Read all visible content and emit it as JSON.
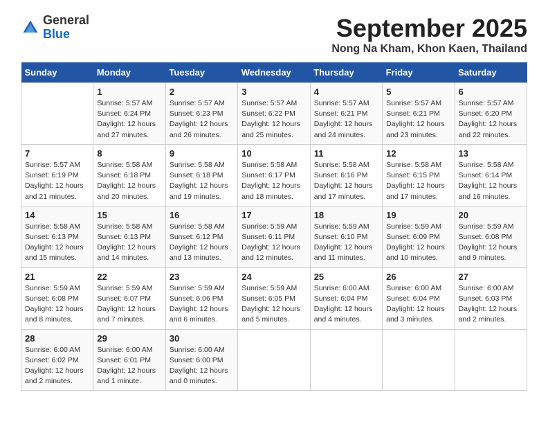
{
  "logo": {
    "general": "General",
    "blue": "Blue"
  },
  "header": {
    "month": "September 2025",
    "location": "Nong Na Kham, Khon Kaen, Thailand"
  },
  "weekdays": [
    "Sunday",
    "Monday",
    "Tuesday",
    "Wednesday",
    "Thursday",
    "Friday",
    "Saturday"
  ],
  "weeks": [
    [
      {
        "day": "",
        "info": ""
      },
      {
        "day": "1",
        "info": "Sunrise: 5:57 AM\nSunset: 6:24 PM\nDaylight: 12 hours\nand 27 minutes."
      },
      {
        "day": "2",
        "info": "Sunrise: 5:57 AM\nSunset: 6:23 PM\nDaylight: 12 hours\nand 26 minutes."
      },
      {
        "day": "3",
        "info": "Sunrise: 5:57 AM\nSunset: 6:22 PM\nDaylight: 12 hours\nand 25 minutes."
      },
      {
        "day": "4",
        "info": "Sunrise: 5:57 AM\nSunset: 6:21 PM\nDaylight: 12 hours\nand 24 minutes."
      },
      {
        "day": "5",
        "info": "Sunrise: 5:57 AM\nSunset: 6:21 PM\nDaylight: 12 hours\nand 23 minutes."
      },
      {
        "day": "6",
        "info": "Sunrise: 5:57 AM\nSunset: 6:20 PM\nDaylight: 12 hours\nand 22 minutes."
      }
    ],
    [
      {
        "day": "7",
        "info": "Sunrise: 5:57 AM\nSunset: 6:19 PM\nDaylight: 12 hours\nand 21 minutes."
      },
      {
        "day": "8",
        "info": "Sunrise: 5:58 AM\nSunset: 6:18 PM\nDaylight: 12 hours\nand 20 minutes."
      },
      {
        "day": "9",
        "info": "Sunrise: 5:58 AM\nSunset: 6:18 PM\nDaylight: 12 hours\nand 19 minutes."
      },
      {
        "day": "10",
        "info": "Sunrise: 5:58 AM\nSunset: 6:17 PM\nDaylight: 12 hours\nand 18 minutes."
      },
      {
        "day": "11",
        "info": "Sunrise: 5:58 AM\nSunset: 6:16 PM\nDaylight: 12 hours\nand 17 minutes."
      },
      {
        "day": "12",
        "info": "Sunrise: 5:58 AM\nSunset: 6:15 PM\nDaylight: 12 hours\nand 17 minutes."
      },
      {
        "day": "13",
        "info": "Sunrise: 5:58 AM\nSunset: 6:14 PM\nDaylight: 12 hours\nand 16 minutes."
      }
    ],
    [
      {
        "day": "14",
        "info": "Sunrise: 5:58 AM\nSunset: 6:13 PM\nDaylight: 12 hours\nand 15 minutes."
      },
      {
        "day": "15",
        "info": "Sunrise: 5:58 AM\nSunset: 6:13 PM\nDaylight: 12 hours\nand 14 minutes."
      },
      {
        "day": "16",
        "info": "Sunrise: 5:58 AM\nSunset: 6:12 PM\nDaylight: 12 hours\nand 13 minutes."
      },
      {
        "day": "17",
        "info": "Sunrise: 5:59 AM\nSunset: 6:11 PM\nDaylight: 12 hours\nand 12 minutes."
      },
      {
        "day": "18",
        "info": "Sunrise: 5:59 AM\nSunset: 6:10 PM\nDaylight: 12 hours\nand 11 minutes."
      },
      {
        "day": "19",
        "info": "Sunrise: 5:59 AM\nSunset: 6:09 PM\nDaylight: 12 hours\nand 10 minutes."
      },
      {
        "day": "20",
        "info": "Sunrise: 5:59 AM\nSunset: 6:08 PM\nDaylight: 12 hours\nand 9 minutes."
      }
    ],
    [
      {
        "day": "21",
        "info": "Sunrise: 5:59 AM\nSunset: 6:08 PM\nDaylight: 12 hours\nand 8 minutes."
      },
      {
        "day": "22",
        "info": "Sunrise: 5:59 AM\nSunset: 6:07 PM\nDaylight: 12 hours\nand 7 minutes."
      },
      {
        "day": "23",
        "info": "Sunrise: 5:59 AM\nSunset: 6:06 PM\nDaylight: 12 hours\nand 6 minutes."
      },
      {
        "day": "24",
        "info": "Sunrise: 5:59 AM\nSunset: 6:05 PM\nDaylight: 12 hours\nand 5 minutes."
      },
      {
        "day": "25",
        "info": "Sunrise: 6:00 AM\nSunset: 6:04 PM\nDaylight: 12 hours\nand 4 minutes."
      },
      {
        "day": "26",
        "info": "Sunrise: 6:00 AM\nSunset: 6:04 PM\nDaylight: 12 hours\nand 3 minutes."
      },
      {
        "day": "27",
        "info": "Sunrise: 6:00 AM\nSunset: 6:03 PM\nDaylight: 12 hours\nand 2 minutes."
      }
    ],
    [
      {
        "day": "28",
        "info": "Sunrise: 6:00 AM\nSunset: 6:02 PM\nDaylight: 12 hours\nand 2 minutes."
      },
      {
        "day": "29",
        "info": "Sunrise: 6:00 AM\nSunset: 6:01 PM\nDaylight: 12 hours\nand 1 minute."
      },
      {
        "day": "30",
        "info": "Sunrise: 6:00 AM\nSunset: 6:00 PM\nDaylight: 12 hours\nand 0 minutes."
      },
      {
        "day": "",
        "info": ""
      },
      {
        "day": "",
        "info": ""
      },
      {
        "day": "",
        "info": ""
      },
      {
        "day": "",
        "info": ""
      }
    ]
  ]
}
